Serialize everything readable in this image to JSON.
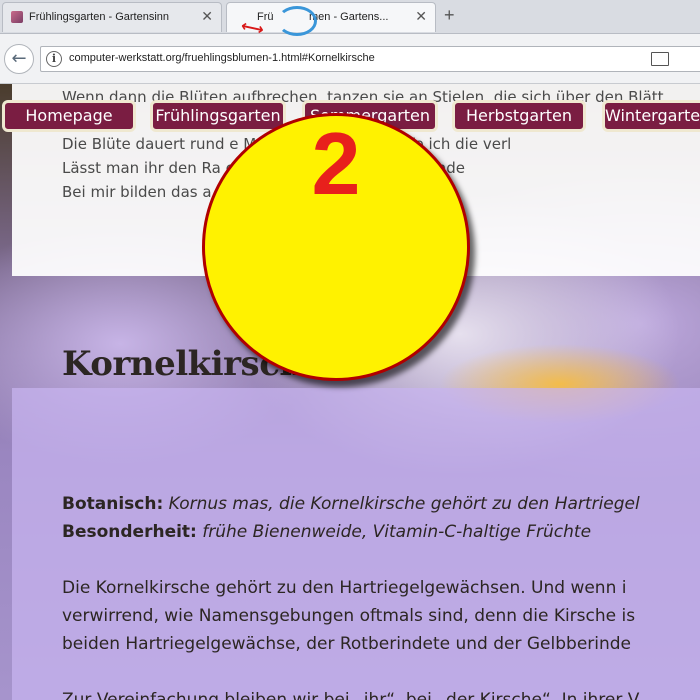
{
  "browser": {
    "tabs": [
      {
        "title": "Frühlingsgarten - Gartensinn"
      },
      {
        "title_prefix": "Frü",
        "title": "men - Gartens..."
      }
    ],
    "url": "computer-werkstatt.org/fruehlingsblumen-1.html#Kornelkirsche"
  },
  "page": {
    "intro_lines": [
      "Wenn dann die Blüten aufbrechen, tanzen sie an Stielen, die sich über den Blätt",
      "Die Blüte dauert rund e                                  Mai bis Juni. Dann zupfe ich die verl",
      "Lässt man ihr den Ra                                       cm aus. Wird sie zwischen ande",
      "Bei mir bilden das a                                        gißmeinnicht und die große s"
    ],
    "nav": [
      "Homepage",
      "Frühlingsgarten",
      "Sommergarten",
      "Herbstgarten",
      "Wintergarten"
    ],
    "heading": "Kornelkirsche",
    "botanisch_label": "Botanisch:",
    "botanisch_value": "Kornus mas, die Kornelkirsche gehört zu den Hartriegel",
    "besonderheit_label": "Besonderheit:",
    "besonderheit_value": "frühe Bienenweide, Vitamin-C-haltige Früchte",
    "body_lines": [
      "Die Kornelkirsche gehört zu den Hartriegelgewächsen. Und wenn i",
      "verwirrend, wie Namensgebungen oftmals sind, denn die Kirsche is",
      "beiden Hartriegelgewächse, der Rotberindete und der Gelbberinde",
      "Zur Vereinfachung bleiben wir bei „ihr“, bei „der Kirsche“. In ihrer V"
    ]
  },
  "overlay": {
    "step_number": "2"
  }
}
